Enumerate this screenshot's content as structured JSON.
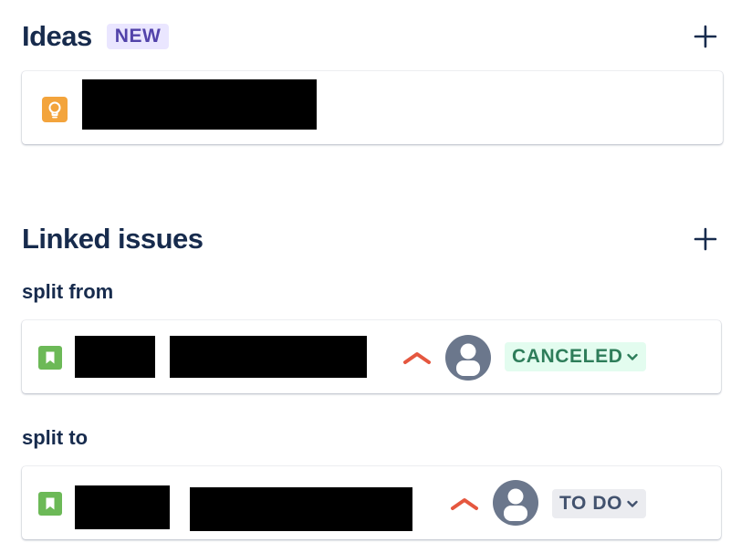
{
  "ideas": {
    "title": "Ideas",
    "badge": "NEW",
    "add_icon": "plus-icon",
    "item_icon": "lightbulb-icon",
    "item_icon_color": "#f3a43c"
  },
  "linked_issues": {
    "title": "Linked issues",
    "add_icon": "plus-icon",
    "groups": [
      {
        "label": "split from",
        "issue": {
          "type_icon": "story-icon",
          "priority_icon": "priority-high-icon",
          "assignee_icon": "avatar-default-icon",
          "status": "CANCELED",
          "status_color": "#2e7d5a",
          "status_bg": "#e3fcef"
        }
      },
      {
        "label": "split to",
        "issue": {
          "type_icon": "story-icon",
          "priority_icon": "priority-high-icon",
          "assignee_icon": "avatar-default-icon",
          "status": "TO DO",
          "status_color": "#42526e",
          "status_bg": "#ebecf0"
        }
      }
    ]
  },
  "colors": {
    "heading": "#172b4d",
    "priority": "#e5573f",
    "story": "#6cb957",
    "avatar": "#6b778c"
  }
}
